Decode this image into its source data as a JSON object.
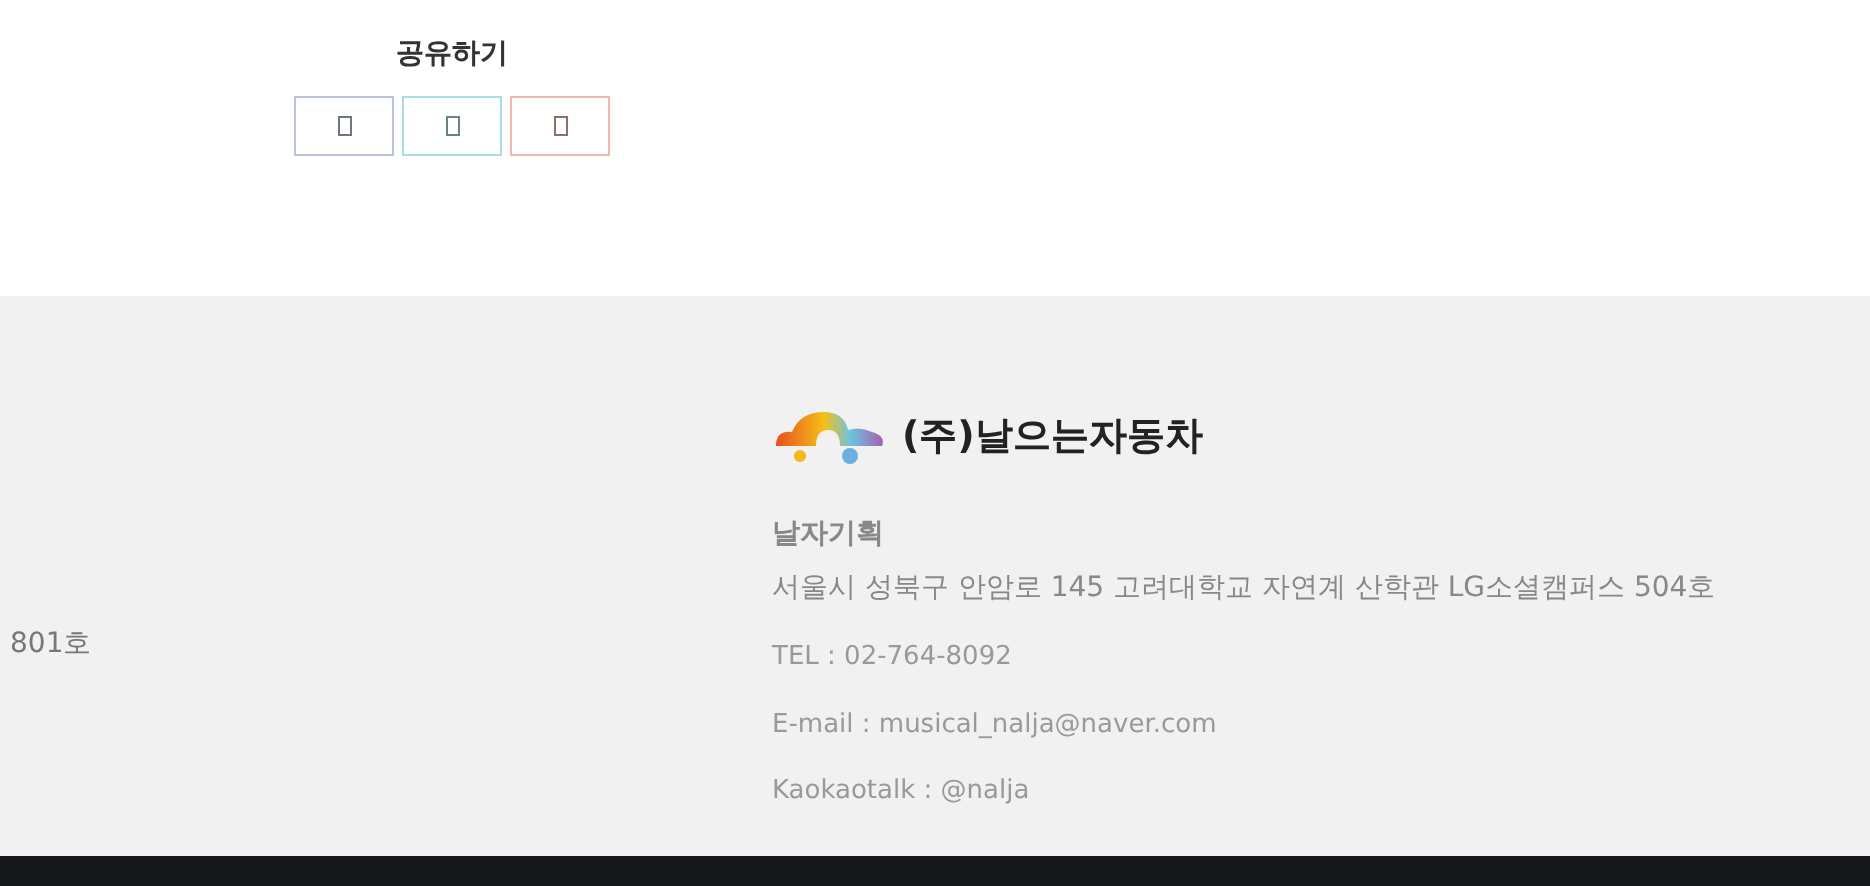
{
  "share": {
    "title": "공유하기",
    "buttons": [
      {
        "color": "#b9c3e0"
      },
      {
        "color": "#a8dde6"
      },
      {
        "color": "#f0b8b0"
      }
    ]
  },
  "footer": {
    "left_text": "801호",
    "company": "(주)날으는자동차",
    "name": "날자기획",
    "address": "서울시 성북구 안암로 145 고려대학교 자연계 산학관 LG소셜캠퍼스 504호",
    "contacts": [
      "TEL : 02-764-8092",
      "E-mail : musical_nalja@naver.com",
      "Kaokaotalk : @nalja"
    ]
  }
}
